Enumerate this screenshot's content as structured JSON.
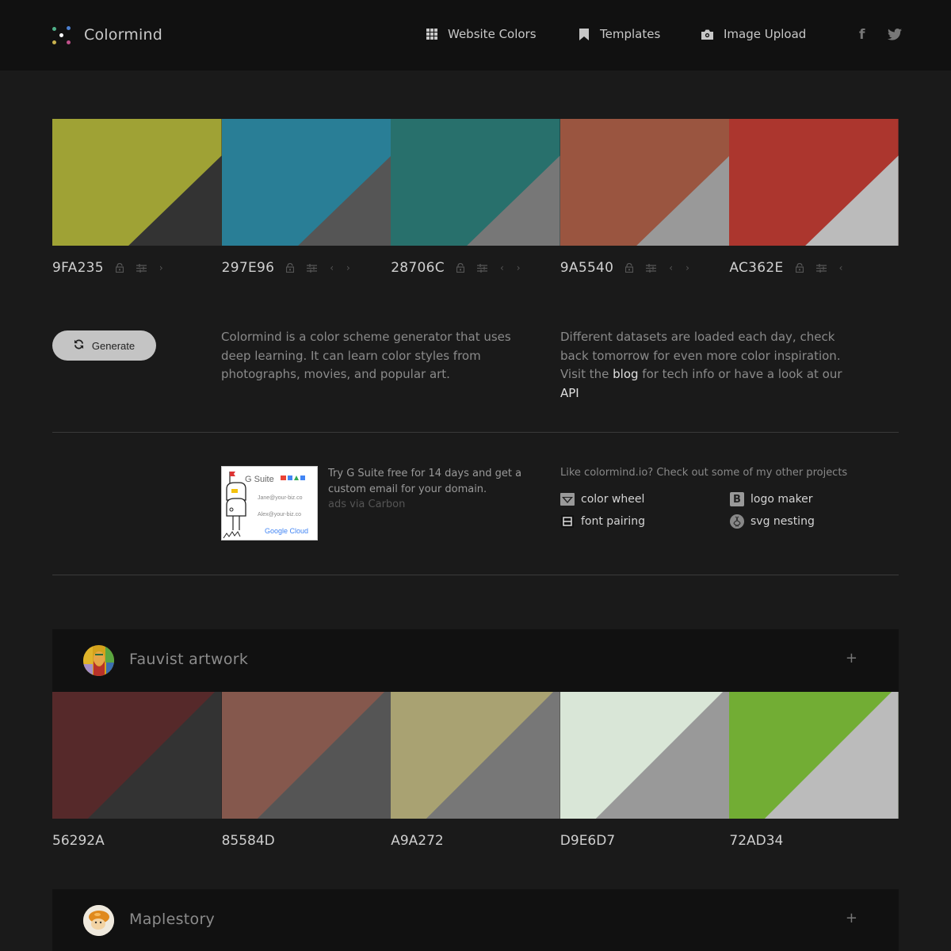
{
  "header": {
    "brand": "Colormind",
    "logo_dot_colors": [
      "#4fb089",
      "#4b7fd0",
      "#ffffff",
      "#c9b24e",
      "#c0508a"
    ],
    "nav": [
      {
        "label": "Website Colors",
        "icon": "grid-icon"
      },
      {
        "label": "Templates",
        "icon": "bookmark-icon"
      },
      {
        "label": "Image Upload",
        "icon": "camera-icon"
      }
    ],
    "social": [
      {
        "label": "f",
        "icon": "facebook-icon"
      },
      {
        "label": "twitter",
        "icon": "twitter-icon"
      }
    ]
  },
  "main_palette": {
    "swatches": [
      {
        "hex": "9FA235",
        "color": "#9FA235",
        "shade": "#333333",
        "controls": [
          "lock",
          "adjust",
          "next"
        ]
      },
      {
        "hex": "297E96",
        "color": "#297E96",
        "shade": "#555555",
        "controls": [
          "lock",
          "adjust",
          "prev",
          "next"
        ]
      },
      {
        "hex": "28706C",
        "color": "#28706C",
        "shade": "#777777",
        "controls": [
          "lock",
          "adjust",
          "prev",
          "next"
        ]
      },
      {
        "hex": "9A5540",
        "color": "#9A5540",
        "shade": "#999999",
        "controls": [
          "lock",
          "adjust",
          "prev",
          "next"
        ]
      },
      {
        "hex": "AC362E",
        "color": "#AC362E",
        "shade": "#BBBBBB",
        "controls": [
          "lock",
          "adjust",
          "prev"
        ]
      }
    ]
  },
  "generate": {
    "label": "Generate"
  },
  "intro": {
    "left": "Colormind is a color scheme generator that uses deep learning. It can learn color styles from photographs, movies, and popular art.",
    "right_prefix": "Different datasets are loaded each day, check back tomorrow for even more color inspiration. Visit the ",
    "blog_link": "blog",
    "right_middle": " for tech info or have a look at our ",
    "api_link": "API"
  },
  "ad": {
    "image_brand": "G Suite",
    "image_email_1": "Jane@your-biz.co",
    "image_email_2": "Alex@your-biz.co",
    "image_footer": "Google Cloud",
    "text": "Try G Suite free for 14 days and get a custom email for your domain.",
    "via": "ads via Carbon"
  },
  "projects": {
    "title": "Like colormind.io? Check out some of my other projects",
    "items": [
      {
        "label": "color wheel",
        "icon": "color-wheel-icon"
      },
      {
        "label": "logo maker",
        "icon": "logo-maker-icon"
      },
      {
        "label": "font pairing",
        "icon": "font-pairing-icon"
      },
      {
        "label": "svg nesting",
        "icon": "svg-nesting-icon"
      }
    ]
  },
  "datasets": [
    {
      "title": "Fauvist artwork",
      "expand_label": "+",
      "swatches": [
        {
          "hex": "56292A",
          "color": "#56292A",
          "shade": "#333333"
        },
        {
          "hex": "85584D",
          "color": "#85584D",
          "shade": "#555555"
        },
        {
          "hex": "A9A272",
          "color": "#A9A272",
          "shade": "#777777"
        },
        {
          "hex": "D9E6D7",
          "color": "#D9E6D7",
          "shade": "#999999"
        },
        {
          "hex": "72AD34",
          "color": "#72AD34",
          "shade": "#BBBBBB"
        }
      ]
    },
    {
      "title": "Maplestory",
      "expand_label": "+"
    }
  ]
}
